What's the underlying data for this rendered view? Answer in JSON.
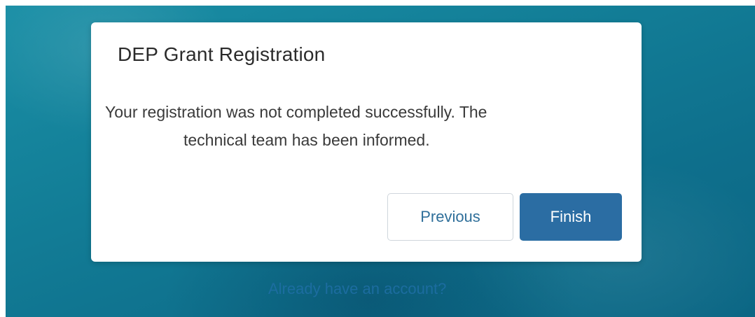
{
  "modal": {
    "title": "DEP Grant Registration",
    "message_line1": "Your registration was not completed successfully. The",
    "message_line2": "technical team has been informed.",
    "previous_label": "Previous",
    "finish_label": "Finish"
  },
  "footer": {
    "account_link": "Already have an account?"
  },
  "colors": {
    "background": "#137f98",
    "primary_button": "#2b6da3",
    "secondary_button_text": "#2f6f9a",
    "link": "#1f6fa6"
  }
}
